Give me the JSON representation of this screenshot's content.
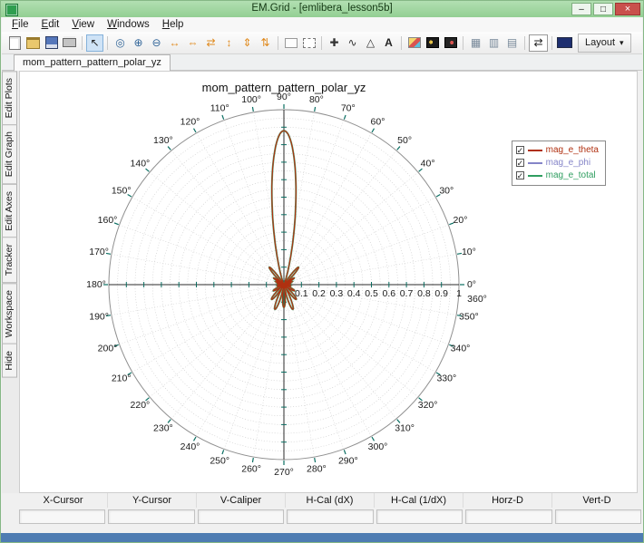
{
  "window": {
    "title": "EM.Grid - [emlibera_lesson5b]",
    "controls": {
      "minimize": "–",
      "maximize": "□",
      "close": "×"
    }
  },
  "menu": {
    "items": [
      "File",
      "Edit",
      "View",
      "Windows",
      "Help"
    ]
  },
  "toolbar": {
    "layout_label": "Layout",
    "layout_arrow": "▾",
    "items": [
      {
        "name": "new-file",
        "kind": "page"
      },
      {
        "name": "open-file",
        "kind": "folder"
      },
      {
        "name": "save-file",
        "kind": "floppy"
      },
      {
        "name": "print",
        "kind": "print"
      },
      {
        "kind": "sep"
      },
      {
        "name": "select-cursor",
        "kind": "glyph",
        "glyph": "↖",
        "color": "#222222",
        "active": true
      },
      {
        "kind": "sep"
      },
      {
        "name": "zoom-region",
        "kind": "glyph",
        "glyph": "◎",
        "color": "#336699"
      },
      {
        "name": "zoom-in",
        "kind": "glyph",
        "glyph": "⊕",
        "color": "#336699"
      },
      {
        "name": "zoom-out",
        "kind": "glyph",
        "glyph": "⊖",
        "color": "#336699"
      },
      {
        "name": "stretch-x",
        "kind": "glyph",
        "glyph": "↔",
        "color": "#e08a1e"
      },
      {
        "name": "expand-x",
        "kind": "glyph",
        "glyph": "⇔",
        "color": "#e08a1e"
      },
      {
        "name": "swap-x",
        "kind": "glyph",
        "glyph": "⇄",
        "color": "#e08a1e"
      },
      {
        "name": "stretch-y",
        "kind": "glyph",
        "glyph": "↕",
        "color": "#e08a1e"
      },
      {
        "name": "expand-y",
        "kind": "glyph",
        "glyph": "⇕",
        "color": "#e08a1e"
      },
      {
        "name": "swap-y",
        "kind": "glyph",
        "glyph": "⇅",
        "color": "#e08a1e"
      },
      {
        "kind": "sep"
      },
      {
        "name": "rect-region",
        "kind": "rect"
      },
      {
        "name": "dashed-region",
        "kind": "rect-dashed"
      },
      {
        "kind": "sep"
      },
      {
        "name": "crosshair-tool",
        "kind": "glyph",
        "glyph": "✚",
        "color": "#333333"
      },
      {
        "name": "curve-trace-tool",
        "kind": "glyph",
        "glyph": "∿",
        "color": "#333333"
      },
      {
        "name": "polygon-tool",
        "kind": "glyph",
        "glyph": "△",
        "color": "#333333"
      },
      {
        "name": "text-tool",
        "kind": "glyph",
        "glyph": "A",
        "color": "#222222"
      },
      {
        "kind": "sep"
      },
      {
        "name": "image-tool",
        "kind": "img"
      },
      {
        "name": "fill-pattern-1",
        "kind": "dark1"
      },
      {
        "name": "fill-pattern-2",
        "kind": "dark2"
      },
      {
        "kind": "sep"
      },
      {
        "name": "grid-columns",
        "kind": "glyph",
        "glyph": "▦",
        "color": "#778899"
      },
      {
        "name": "grid-vertical",
        "kind": "glyph",
        "glyph": "▥",
        "color": "#778899"
      },
      {
        "name": "grid-horizontal",
        "kind": "glyph",
        "glyph": "▤",
        "color": "#778899"
      },
      {
        "kind": "sep"
      },
      {
        "name": "measure-width",
        "kind": "glyph",
        "glyph": "⇄",
        "color": "#222222",
        "boxed": true
      },
      {
        "kind": "sep"
      },
      {
        "name": "color-swatch",
        "kind": "swatch"
      }
    ]
  },
  "tabs": {
    "active": "mom_pattern_pattern_polar_yz"
  },
  "sidebar": {
    "items": [
      "Edit Plots",
      "Edit Graph",
      "Edit Axes",
      "Tracker",
      "Workspace",
      "Hide"
    ]
  },
  "chart_data": {
    "type": "polar-line",
    "title": "mom_pattern_pattern_polar_yz",
    "check_glyph": "✓",
    "angle_labels_deg": [
      0,
      10,
      20,
      30,
      40,
      50,
      60,
      70,
      80,
      90,
      100,
      110,
      120,
      130,
      140,
      150,
      160,
      170,
      180,
      190,
      200,
      210,
      220,
      230,
      240,
      250,
      260,
      270,
      280,
      290,
      300,
      310,
      320,
      330,
      340,
      350,
      360
    ],
    "radial_tick_labels": [
      "0.1",
      "0.2",
      "0.3",
      "0.4",
      "0.5",
      "0.6",
      "0.7",
      "0.8",
      "0.9",
      "1"
    ],
    "radial_max": 1,
    "grid": {
      "circle_step": 0.05,
      "spoke_step_deg": 10
    },
    "series": [
      {
        "name": "mag_e_theta",
        "color": "#b03010",
        "checked": true
      },
      {
        "name": "mag_e_phi",
        "color": "#8585c8",
        "checked": true
      },
      {
        "name": "mag_e_total",
        "color": "#2f9e60",
        "checked": true
      }
    ],
    "pattern": {
      "main": {
        "center_deg": 90,
        "amp": 0.88,
        "sigma_deg": 10.5
      },
      "upper_petals": [
        [
          40,
          9,
          0.13
        ],
        [
          57,
          8,
          0.07
        ],
        [
          70,
          7,
          0.05
        ],
        [
          82,
          6,
          0.04
        ]
      ],
      "lower_petals": {
        "start_deg": 10,
        "step_deg": 20,
        "half_width_deg": 10,
        "amps": [
          0.04,
          0.07,
          0.11,
          0.15,
          0.13,
          0.15,
          0.11,
          0.07,
          0.04
        ]
      }
    },
    "colors": {
      "grid_circle": "#c9c9c9",
      "grid_spoke": "#cfcfcf",
      "axis": "#2b2b2b",
      "tick": "#0a6e62",
      "outer_circle": "#909090",
      "label": "#1a1a1a"
    }
  },
  "status": {
    "columns": [
      "X-Cursor",
      "Y-Cursor",
      "V-Caliper",
      "H-Cal (dX)",
      "H-Cal (1/dX)",
      "Horz-D",
      "Vert-D"
    ],
    "values": [
      "",
      "",
      "",
      "",
      "",
      "",
      ""
    ]
  }
}
